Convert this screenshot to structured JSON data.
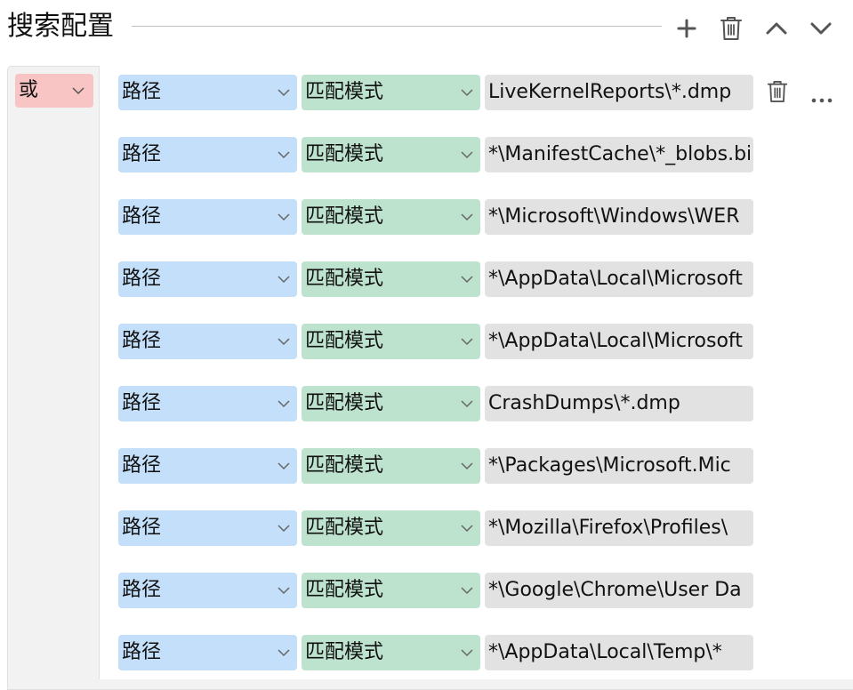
{
  "header": {
    "title": "搜索配置"
  },
  "logic": {
    "value": "或"
  },
  "rows": [
    {
      "field": "路径",
      "mode": "匹配模式",
      "value": "LiveKernelReports\\*.dmp"
    },
    {
      "field": "路径",
      "mode": "匹配模式",
      "value": "*\\ManifestCache\\*_blobs.bin"
    },
    {
      "field": "路径",
      "mode": "匹配模式",
      "value": "*\\Microsoft\\Windows\\WER"
    },
    {
      "field": "路径",
      "mode": "匹配模式",
      "value": "*\\AppData\\Local\\Microsoft"
    },
    {
      "field": "路径",
      "mode": "匹配模式",
      "value": "*\\AppData\\Local\\Microsoft"
    },
    {
      "field": "路径",
      "mode": "匹配模式",
      "value": "CrashDumps\\*.dmp"
    },
    {
      "field": "路径",
      "mode": "匹配模式",
      "value": "*\\Packages\\Microsoft.Mic"
    },
    {
      "field": "路径",
      "mode": "匹配模式",
      "value": "*\\Mozilla\\Firefox\\Profiles\\"
    },
    {
      "field": "路径",
      "mode": "匹配模式",
      "value": "*\\Google\\Chrome\\User Da"
    },
    {
      "field": "路径",
      "mode": "匹配模式",
      "value": "*\\AppData\\Local\\Temp\\*"
    }
  ],
  "icons": {
    "add": "plus-icon",
    "delete": "trash-icon",
    "up": "chevron-up-icon",
    "down": "chevron-down-icon",
    "more": "more-icon"
  }
}
